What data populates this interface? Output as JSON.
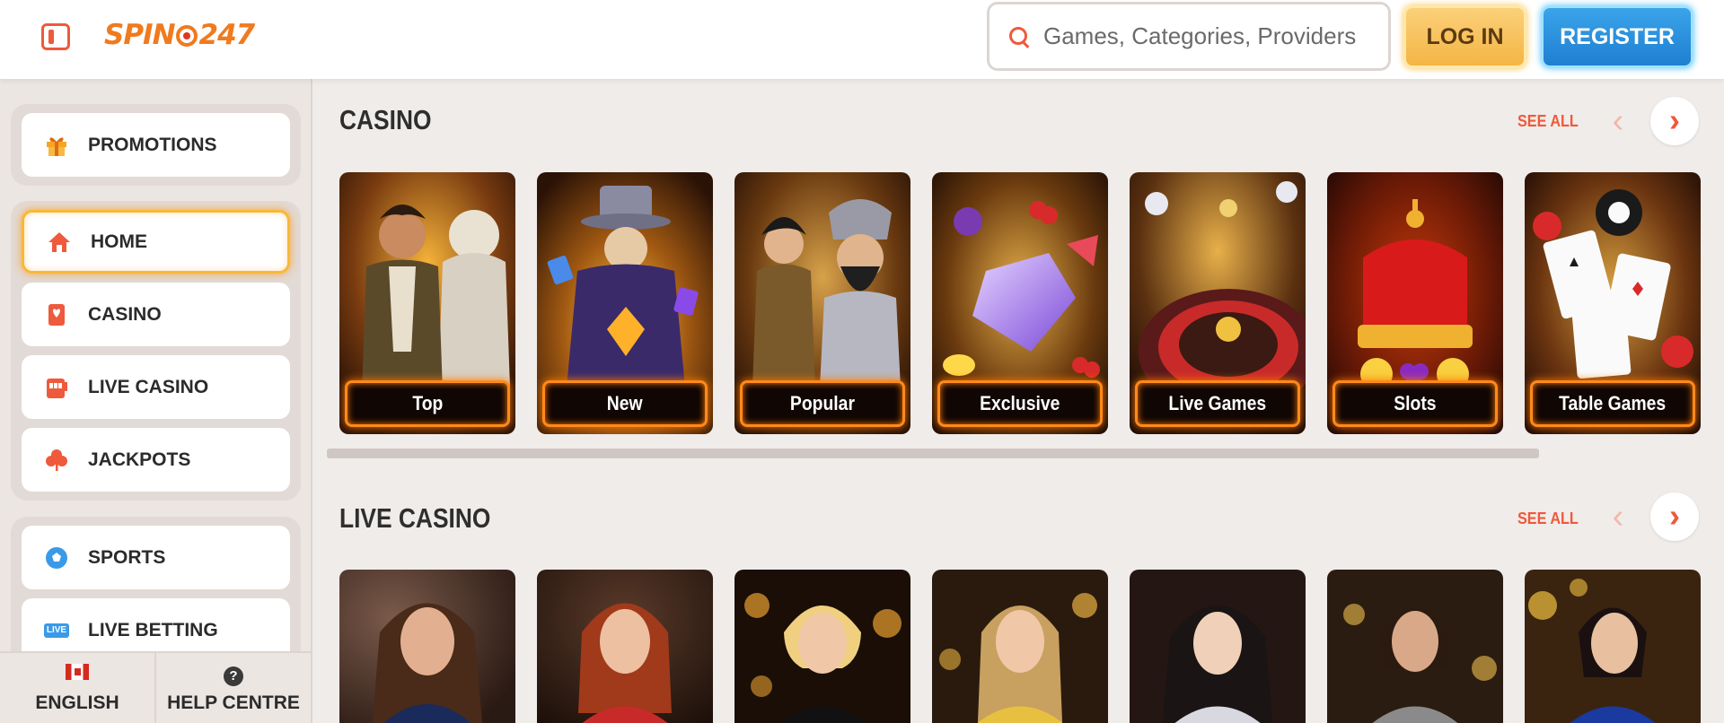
{
  "header": {
    "logo_text_1": "SPIN",
    "logo_text_2": "247",
    "search_placeholder": "Games, Categories, Providers",
    "login_label": "LOG IN",
    "register_label": "REGISTER"
  },
  "sidebar": {
    "promotions": "PROMOTIONS",
    "items": [
      {
        "label": "HOME",
        "icon": "home-icon",
        "active": true
      },
      {
        "label": "CASINO",
        "icon": "card-icon"
      },
      {
        "label": "LIVE CASINO",
        "icon": "slot-machine-icon"
      },
      {
        "label": "JACKPOTS",
        "icon": "clover-icon"
      }
    ],
    "sports": [
      {
        "label": "SPORTS",
        "icon": "soccer-ball-icon"
      },
      {
        "label": "LIVE BETTING",
        "icon": "live-badge-icon",
        "badge": "LIVE"
      }
    ],
    "footer": {
      "language": "ENGLISH",
      "help": "HELP CENTRE",
      "help_symbol": "?"
    }
  },
  "casino": {
    "title": "CASINO",
    "see_all": "SEE ALL",
    "tiles": [
      "Top",
      "New",
      "Popular",
      "Exclusive",
      "Live Games",
      "Slots",
      "Table Games"
    ]
  },
  "live_casino": {
    "title": "LIVE CASINO",
    "see_all": "SEE ALL"
  },
  "colors": {
    "accent": "#ee5a3b",
    "brand": "#f07a1e",
    "login": "#f4b544",
    "register": "#1f7fd1"
  }
}
